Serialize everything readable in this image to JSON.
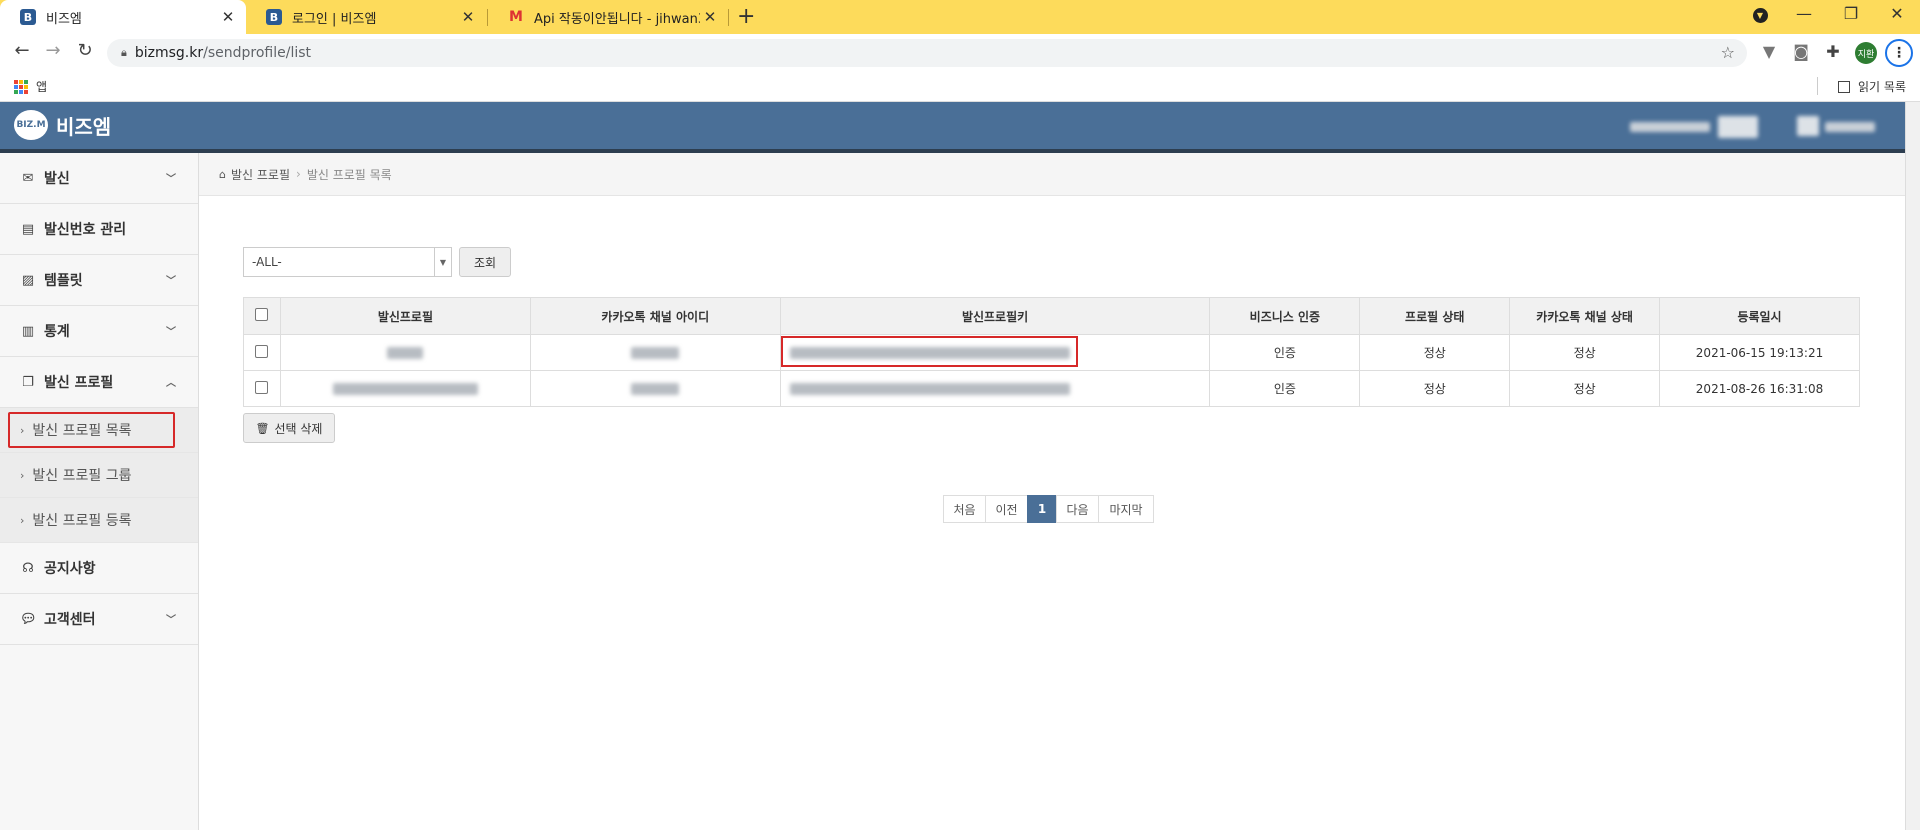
{
  "browser": {
    "tabs": [
      {
        "title": "비즈엠",
        "favicon": "B",
        "active": true
      },
      {
        "title": "로그인 | 비즈엠",
        "favicon": "B",
        "active": false
      },
      {
        "title": "Api 작동이안됩니다 - jihwan322",
        "favicon": "M",
        "active": false
      }
    ],
    "url_domain": "bizmsg.kr",
    "url_path": "/sendprofile/list",
    "profile_initials": "지환",
    "bookmarks": {
      "apps_label": "앱",
      "reading_list_label": "읽기 목록"
    }
  },
  "app": {
    "logo_mark": "BIZ.M",
    "logo_text": "비즈엠",
    "accent_color": "#4a6f97"
  },
  "sidebar": {
    "items": [
      {
        "label": "발신",
        "icon": "envelope-icon",
        "expandable": true,
        "expanded": false
      },
      {
        "label": "발신번호 관리",
        "icon": "list-icon",
        "expandable": false
      },
      {
        "label": "템플릿",
        "icon": "image-icon",
        "expandable": true,
        "expanded": false
      },
      {
        "label": "통계",
        "icon": "bar-chart-icon",
        "expandable": true,
        "expanded": false
      },
      {
        "label": "발신 프로필",
        "icon": "copy-icon",
        "expandable": true,
        "expanded": true
      },
      {
        "label": "공지사항",
        "icon": "headset-icon",
        "expandable": false
      },
      {
        "label": "고객센터",
        "icon": "comments-icon",
        "expandable": true,
        "expanded": false
      }
    ],
    "subitems": [
      {
        "label": "발신 프로필 목록",
        "active": true
      },
      {
        "label": "발신 프로필 그룹",
        "active": false
      },
      {
        "label": "발신 프로필 등록",
        "active": false
      }
    ]
  },
  "breadcrumb": {
    "root": "발신 프로필",
    "current": "발신 프로필 목록"
  },
  "filter": {
    "select_value": "-ALL-",
    "search_button": "조회"
  },
  "table": {
    "headers": [
      "발신프로필",
      "카카오톡 채널 아이디",
      "발신프로필키",
      "비즈니스 인증",
      "프로필 상태",
      "카카오톡 채널 상태",
      "등록일시"
    ],
    "rows": [
      {
        "business_auth": "인증",
        "profile_status": "정상",
        "channel_status": "정상",
        "registered": "2021-06-15 19:13:21"
      },
      {
        "business_auth": "인증",
        "profile_status": "정상",
        "channel_status": "정상",
        "registered": "2021-08-26 16:31:08"
      }
    ]
  },
  "delete_button": "선택 삭제",
  "pagination": {
    "first": "처음",
    "prev": "이전",
    "current": "1",
    "next": "다음",
    "last": "마지막"
  }
}
